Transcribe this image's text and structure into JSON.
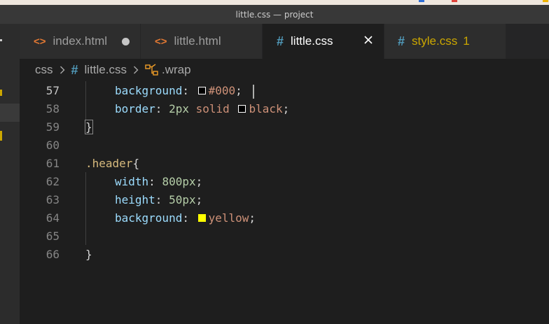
{
  "window": {
    "title": "little.css — project"
  },
  "tabs": [
    {
      "label": "index.html",
      "icon": "html-file-icon",
      "state": "modified"
    },
    {
      "label": "little.html",
      "icon": "html-file-icon",
      "state": "normal"
    },
    {
      "label": "little.css",
      "icon": "css-file-icon",
      "state": "active"
    },
    {
      "label": "style.css",
      "icon": "css-file-icon",
      "state": "warning",
      "badge": "1"
    }
  ],
  "breadcrumb": {
    "folder": "css",
    "file": "little.css",
    "symbol": ".wrap"
  },
  "editor": {
    "lines": [
      {
        "n": "57",
        "tokens": {
          "prop": "background",
          "colon": ":",
          "value": "#000",
          "semi": ";"
        },
        "swatch": "#000000"
      },
      {
        "n": "58",
        "tokens": {
          "prop": "border",
          "colon": ":",
          "num": "2px",
          "kw": "solid",
          "value": "black",
          "semi": ";"
        },
        "swatch": "#000000"
      },
      {
        "n": "59",
        "text": "}"
      },
      {
        "n": "60",
        "text": ""
      },
      {
        "n": "61",
        "tokens": {
          "selector": ".header",
          "brace": "{"
        }
      },
      {
        "n": "62",
        "tokens": {
          "prop": "width",
          "colon": ":",
          "num": "800px",
          "semi": ";"
        }
      },
      {
        "n": "63",
        "tokens": {
          "prop": "height",
          "colon": ":",
          "num": "50px",
          "semi": ";"
        }
      },
      {
        "n": "64",
        "tokens": {
          "prop": "background",
          "colon": ":",
          "value": "yellow",
          "semi": ";"
        },
        "swatch": "#ffff00"
      },
      {
        "n": "65",
        "text": ""
      },
      {
        "n": "66",
        "text": "}"
      }
    ]
  },
  "colors": {
    "editor_bg": "#1e1e1e",
    "tab_active_bg": "#1e1e1e",
    "tab_inactive_bg": "#2d2d2d",
    "property": "#9cdcfe",
    "number": "#b5cea8",
    "string_value": "#ce9178",
    "selector": "#d7ba7d",
    "warning": "#cca700"
  }
}
